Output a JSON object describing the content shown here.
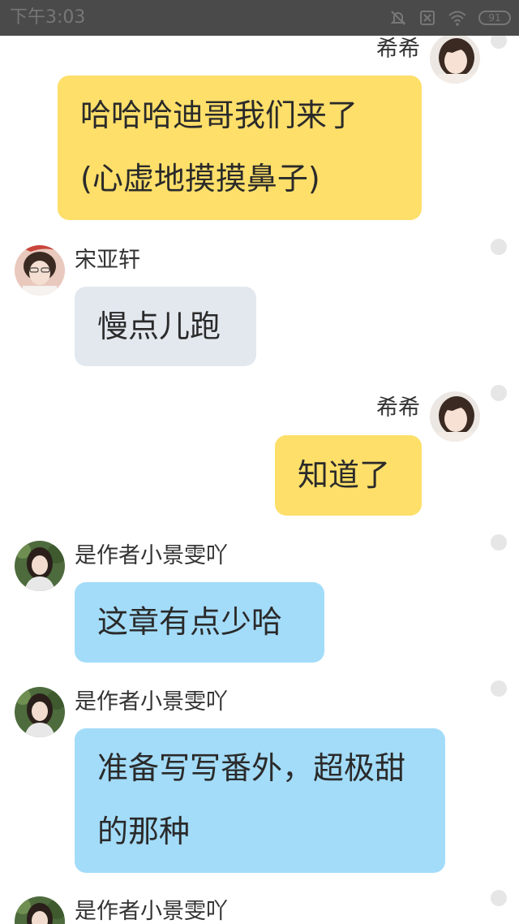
{
  "status_bar": {
    "time": "下午3:03",
    "battery": "91"
  },
  "messages": [
    {
      "side": "right",
      "sender": "希希",
      "text": "哈哈哈迪哥我们来了(心虚地摸摸鼻子)",
      "bubble_color": "#fddf6a"
    },
    {
      "side": "left",
      "sender": "宋亚轩",
      "text": "慢点儿跑",
      "bubble_color": "#e3e8ef"
    },
    {
      "side": "right",
      "sender": "希希",
      "text": "知道了",
      "bubble_color": "#fddf6a"
    },
    {
      "side": "left",
      "sender": "是作者小景雯吖",
      "text": "这章有点少哈",
      "bubble_color": "#a3dcf9"
    },
    {
      "side": "left",
      "sender": "是作者小景雯吖",
      "text": "准备写写番外，超极甜的那种",
      "bubble_color": "#a3dcf9"
    },
    {
      "side": "left",
      "sender": "是作者小景雯吖",
      "text": "",
      "bubble_color": "#a3dcf9"
    }
  ]
}
